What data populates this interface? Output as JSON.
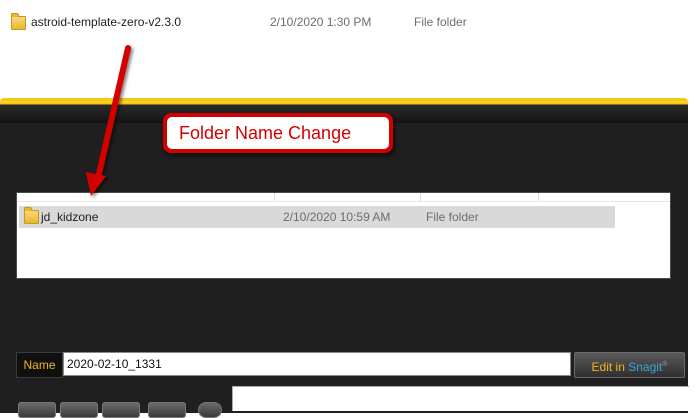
{
  "top_item": {
    "name": "astroid-template-zero-v2.3.0",
    "date": "2/10/2020 1:30 PM",
    "type": "File folder"
  },
  "annotation": {
    "text": "Folder Name Change",
    "color": "#d40000"
  },
  "file_list": {
    "rows": [
      {
        "name": "jd_kidzone",
        "date": "2/10/2020 10:59 AM",
        "type": "File folder",
        "selected": true
      }
    ]
  },
  "name_field": {
    "label": "Name",
    "value": "2020-02-10_1331"
  },
  "edit_button": {
    "prefix": "Edit in",
    "app": "Snagit"
  },
  "toolbar": {
    "icons": [
      "up-arrow-icon",
      "save-icon",
      "clipboard-icon",
      "search-icon",
      "settings-icon"
    ]
  },
  "colors": {
    "panel_bg": "#1f1f1f",
    "accent_yellow": "#f7c812",
    "label_orange": "#f3b51c",
    "snagit_blue": "#3ba7d8"
  }
}
